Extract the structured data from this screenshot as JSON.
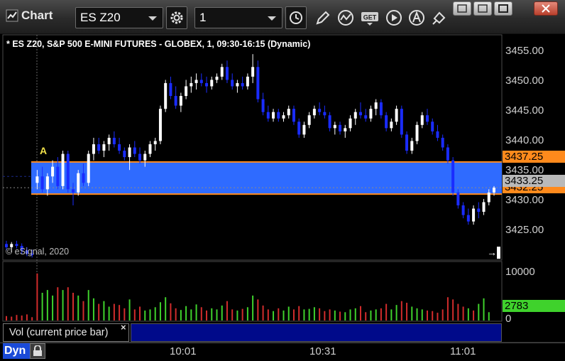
{
  "window": {
    "title": "Chart",
    "symbol_value": "ES Z20",
    "interval_value": "1"
  },
  "chart": {
    "title": "* ES Z20, S&P 500 E-MINI FUTURES - GLOBEX, 1, 09:30-16:15 (Dynamic)",
    "copyright": "© eSignal, 2020",
    "alert_marker": "A",
    "price_labels": [
      "3455.00",
      "3450.00",
      "3445.00",
      "3440.00",
      "3435.00",
      "3430.00",
      "3425.00"
    ],
    "tag_upper": "3437.25",
    "tag_last": "3433.25",
    "tag_lower": "3432.25",
    "volume_labels": [
      "10000",
      "0"
    ],
    "tag_volume": "2783",
    "study_label": "Vol (current price bar)",
    "study_close": "×",
    "time_labels": [
      "10:01",
      "10:31",
      "11:01"
    ],
    "mode_label": "Dyn",
    "colors": {
      "up": "#ffffff",
      "down": "#1a2cff",
      "zone": "#2f6bff",
      "zone_line": "#ff8a1c",
      "vol_up": "#3fd22c",
      "vol_down": "#d22c2c"
    }
  },
  "chart_data": {
    "type": "candlestick",
    "title": "* ES Z20, S&P 500 E-MINI FUTURES - GLOBEX, 1, 09:30-16:15 (Dynamic)",
    "ylim": [
      3422,
      3457
    ],
    "zone": [
      3432.25,
      3437.25
    ],
    "last": 3433.25,
    "candles": [
      [
        3424.5,
        3425.0,
        3423.5,
        3424.0
      ],
      [
        3424.0,
        3424.8,
        3423.2,
        3424.5
      ],
      [
        3424.5,
        3425.0,
        3423.8,
        3424.2
      ],
      [
        3424.2,
        3424.6,
        3423.0,
        3423.5
      ],
      [
        3423.5,
        3424.0,
        3422.6,
        3423.0
      ],
      [
        3423.0,
        3423.6,
        3422.4,
        3422.8
      ],
      [
        3434.0,
        3436.0,
        3433.0,
        3435.0
      ],
      [
        3435.0,
        3436.5,
        3432.5,
        3433.0
      ],
      [
        3433.0,
        3435.5,
        3432.0,
        3435.0
      ],
      [
        3435.0,
        3437.5,
        3434.0,
        3436.5
      ],
      [
        3436.5,
        3438.0,
        3433.0,
        3433.5
      ],
      [
        3433.5,
        3439.0,
        3433.0,
        3438.5
      ],
      [
        3438.5,
        3439.0,
        3432.5,
        3433.0
      ],
      [
        3433.0,
        3434.0,
        3430.5,
        3432.5
      ],
      [
        3432.5,
        3436.0,
        3432.0,
        3435.5
      ],
      [
        3435.5,
        3437.0,
        3433.5,
        3434.0
      ],
      [
        3434.0,
        3439.0,
        3433.5,
        3438.5
      ],
      [
        3438.5,
        3441.0,
        3437.5,
        3440.0
      ],
      [
        3440.0,
        3441.0,
        3438.5,
        3439.0
      ],
      [
        3439.0,
        3440.5,
        3438.0,
        3440.0
      ],
      [
        3440.0,
        3441.5,
        3439.0,
        3441.0
      ],
      [
        3441.0,
        3442.0,
        3439.5,
        3440.0
      ],
      [
        3440.0,
        3441.0,
        3438.5,
        3439.0
      ],
      [
        3439.0,
        3439.5,
        3437.5,
        3438.0
      ],
      [
        3438.0,
        3440.0,
        3436.0,
        3439.5
      ],
      [
        3439.5,
        3440.5,
        3438.0,
        3438.5
      ],
      [
        3438.5,
        3439.5,
        3437.0,
        3437.5
      ],
      [
        3437.5,
        3439.0,
        3436.5,
        3438.5
      ],
      [
        3438.5,
        3440.5,
        3438.0,
        3440.0
      ],
      [
        3440.0,
        3441.0,
        3439.0,
        3440.5
      ],
      [
        3440.5,
        3446.0,
        3440.0,
        3445.5
      ],
      [
        3445.5,
        3450.0,
        3445.0,
        3449.5
      ],
      [
        3449.5,
        3450.5,
        3447.0,
        3447.5
      ],
      [
        3447.5,
        3449.0,
        3445.5,
        3446.0
      ],
      [
        3446.0,
        3448.0,
        3445.0,
        3447.5
      ],
      [
        3447.5,
        3450.0,
        3447.0,
        3449.0
      ],
      [
        3449.0,
        3450.5,
        3448.0,
        3449.5
      ],
      [
        3449.5,
        3451.0,
        3448.5,
        3450.0
      ],
      [
        3450.0,
        3451.0,
        3449.0,
        3449.5
      ],
      [
        3449.5,
        3450.5,
        3448.0,
        3449.0
      ],
      [
        3449.0,
        3450.5,
        3448.5,
        3450.0
      ],
      [
        3450.0,
        3451.0,
        3449.5,
        3450.5
      ],
      [
        3450.5,
        3452.5,
        3450.0,
        3452.0
      ],
      [
        3452.0,
        3453.0,
        3449.5,
        3450.0
      ],
      [
        3450.0,
        3451.0,
        3448.5,
        3449.0
      ],
      [
        3449.0,
        3450.0,
        3448.0,
        3449.5
      ],
      [
        3449.5,
        3450.5,
        3448.5,
        3449.0
      ],
      [
        3449.0,
        3451.0,
        3448.5,
        3450.5
      ],
      [
        3450.5,
        3454.0,
        3449.5,
        3452.0
      ],
      [
        3452.0,
        3453.0,
        3446.5,
        3447.0
      ],
      [
        3447.0,
        3448.0,
        3444.5,
        3445.0
      ],
      [
        3445.0,
        3446.0,
        3443.5,
        3444.0
      ],
      [
        3444.0,
        3445.5,
        3443.5,
        3445.0
      ],
      [
        3445.0,
        3445.5,
        3443.5,
        3444.0
      ],
      [
        3444.0,
        3445.0,
        3443.5,
        3444.5
      ],
      [
        3444.5,
        3446.0,
        3444.0,
        3445.5
      ],
      [
        3445.5,
        3446.0,
        3443.0,
        3443.5
      ],
      [
        3443.5,
        3444.0,
        3441.0,
        3441.5
      ],
      [
        3441.5,
        3443.5,
        3441.0,
        3443.0
      ],
      [
        3443.0,
        3445.0,
        3442.5,
        3444.5
      ],
      [
        3444.5,
        3446.0,
        3444.0,
        3445.5
      ],
      [
        3445.5,
        3446.5,
        3444.5,
        3445.0
      ],
      [
        3445.0,
        3446.0,
        3444.0,
        3444.5
      ],
      [
        3444.5,
        3445.0,
        3442.0,
        3442.5
      ],
      [
        3442.5,
        3443.5,
        3441.5,
        3443.0
      ],
      [
        3443.0,
        3443.5,
        3441.5,
        3442.0
      ],
      [
        3442.0,
        3443.0,
        3441.0,
        3442.5
      ],
      [
        3442.5,
        3444.5,
        3442.0,
        3444.0
      ],
      [
        3444.0,
        3445.5,
        3443.0,
        3445.0
      ],
      [
        3445.0,
        3446.5,
        3444.0,
        3444.5
      ],
      [
        3444.5,
        3445.5,
        3443.5,
        3444.0
      ],
      [
        3444.0,
        3446.0,
        3443.5,
        3445.5
      ],
      [
        3445.5,
        3447.0,
        3444.5,
        3446.5
      ],
      [
        3446.5,
        3447.0,
        3444.0,
        3444.5
      ],
      [
        3444.5,
        3445.0,
        3442.0,
        3442.5
      ],
      [
        3442.5,
        3444.0,
        3442.0,
        3443.5
      ],
      [
        3443.5,
        3446.0,
        3443.0,
        3445.5
      ],
      [
        3445.5,
        3446.0,
        3441.0,
        3441.5
      ],
      [
        3441.5,
        3442.0,
        3438.5,
        3439.0
      ],
      [
        3439.0,
        3441.0,
        3438.5,
        3440.5
      ],
      [
        3440.5,
        3443.5,
        3440.0,
        3443.0
      ],
      [
        3443.0,
        3445.0,
        3442.5,
        3444.5
      ],
      [
        3444.5,
        3445.5,
        3443.0,
        3443.5
      ],
      [
        3443.5,
        3444.0,
        3441.5,
        3442.0
      ],
      [
        3442.0,
        3443.0,
        3440.5,
        3441.0
      ],
      [
        3441.0,
        3441.5,
        3439.0,
        3439.5
      ],
      [
        3439.5,
        3440.0,
        3437.0,
        3437.5
      ],
      [
        3437.5,
        3438.0,
        3432.0,
        3432.5
      ],
      [
        3432.5,
        3433.0,
        3430.0,
        3430.5
      ],
      [
        3430.5,
        3431.0,
        3428.5,
        3429.0
      ],
      [
        3429.0,
        3430.0,
        3427.5,
        3428.0
      ],
      [
        3428.0,
        3430.5,
        3427.5,
        3430.0
      ],
      [
        3430.0,
        3431.0,
        3428.5,
        3429.5
      ],
      [
        3429.5,
        3431.5,
        3429.0,
        3431.0
      ],
      [
        3431.0,
        3433.0,
        3430.5,
        3432.5
      ],
      [
        3432.5,
        3433.5,
        3432.0,
        3433.25
      ]
    ],
    "volume": [
      [
        0.08,
        0
      ],
      [
        0.07,
        0
      ],
      [
        0.1,
        0
      ],
      [
        0.09,
        0
      ],
      [
        0.11,
        0
      ],
      [
        0.06,
        0
      ],
      [
        0.85,
        0
      ],
      [
        0.5,
        1
      ],
      [
        0.55,
        1
      ],
      [
        0.45,
        1
      ],
      [
        0.6,
        0
      ],
      [
        0.55,
        1
      ],
      [
        0.6,
        0
      ],
      [
        0.5,
        0
      ],
      [
        0.45,
        1
      ],
      [
        0.35,
        0
      ],
      [
        0.55,
        1
      ],
      [
        0.4,
        1
      ],
      [
        0.3,
        0
      ],
      [
        0.35,
        1
      ],
      [
        0.25,
        1
      ],
      [
        0.3,
        0
      ],
      [
        0.28,
        0
      ],
      [
        0.22,
        0
      ],
      [
        0.38,
        1
      ],
      [
        0.2,
        0
      ],
      [
        0.25,
        0
      ],
      [
        0.18,
        1
      ],
      [
        0.2,
        1
      ],
      [
        0.24,
        1
      ],
      [
        0.33,
        1
      ],
      [
        0.42,
        1
      ],
      [
        0.31,
        0
      ],
      [
        0.22,
        0
      ],
      [
        0.19,
        1
      ],
      [
        0.26,
        1
      ],
      [
        0.2,
        1
      ],
      [
        0.29,
        1
      ],
      [
        0.24,
        0
      ],
      [
        0.18,
        0
      ],
      [
        0.22,
        1
      ],
      [
        0.2,
        1
      ],
      [
        0.27,
        1
      ],
      [
        0.35,
        0
      ],
      [
        0.2,
        0
      ],
      [
        0.18,
        1
      ],
      [
        0.21,
        0
      ],
      [
        0.24,
        1
      ],
      [
        0.45,
        1
      ],
      [
        0.38,
        0
      ],
      [
        0.27,
        0
      ],
      [
        0.2,
        0
      ],
      [
        0.17,
        1
      ],
      [
        0.22,
        0
      ],
      [
        0.18,
        1
      ],
      [
        0.25,
        1
      ],
      [
        0.2,
        0
      ],
      [
        0.26,
        0
      ],
      [
        0.2,
        1
      ],
      [
        0.21,
        1
      ],
      [
        0.24,
        1
      ],
      [
        0.22,
        0
      ],
      [
        0.17,
        0
      ],
      [
        0.2,
        0
      ],
      [
        0.18,
        1
      ],
      [
        0.16,
        0
      ],
      [
        0.15,
        1
      ],
      [
        0.2,
        1
      ],
      [
        0.22,
        1
      ],
      [
        0.26,
        0
      ],
      [
        0.15,
        0
      ],
      [
        0.18,
        1
      ],
      [
        0.2,
        1
      ],
      [
        0.22,
        0
      ],
      [
        0.3,
        0
      ],
      [
        0.2,
        1
      ],
      [
        0.28,
        1
      ],
      [
        0.35,
        0
      ],
      [
        0.32,
        0
      ],
      [
        0.25,
        1
      ],
      [
        0.22,
        1
      ],
      [
        0.2,
        1
      ],
      [
        0.18,
        0
      ],
      [
        0.17,
        0
      ],
      [
        0.14,
        0
      ],
      [
        0.2,
        0
      ],
      [
        0.42,
        0
      ],
      [
        0.38,
        0
      ],
      [
        0.3,
        0
      ],
      [
        0.25,
        0
      ],
      [
        0.22,
        1
      ],
      [
        0.18,
        0
      ],
      [
        0.3,
        1
      ],
      [
        0.4,
        1
      ],
      [
        0.15,
        1
      ]
    ]
  }
}
